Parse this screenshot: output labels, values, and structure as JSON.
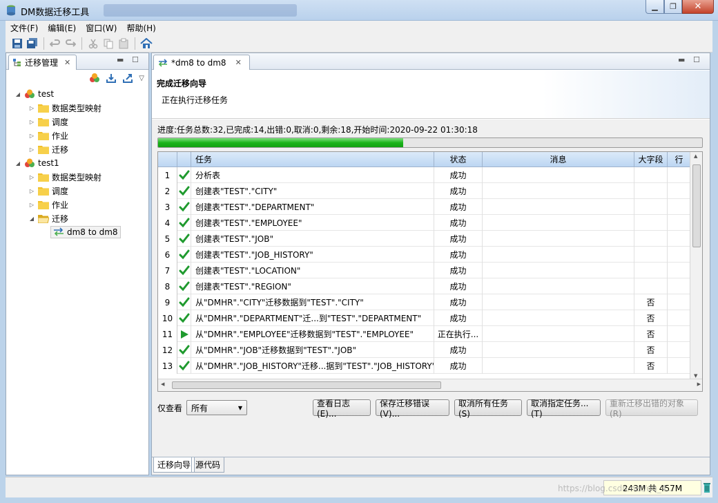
{
  "window": {
    "title": "DM数据迁移工具"
  },
  "menu": [
    "文件(F)",
    "编辑(E)",
    "窗口(W)",
    "帮助(H)"
  ],
  "left_panel": {
    "tab_label": "迁移管理",
    "tree": [
      {
        "label": "test",
        "level": 0,
        "expanded": true,
        "icon": "database-icon"
      },
      {
        "label": "数据类型映射",
        "level": 1,
        "expanded": false,
        "icon": "folder-icon"
      },
      {
        "label": "调度",
        "level": 1,
        "expanded": false,
        "icon": "folder-icon"
      },
      {
        "label": "作业",
        "level": 1,
        "expanded": false,
        "icon": "folder-icon"
      },
      {
        "label": "迁移",
        "level": 1,
        "expanded": false,
        "icon": "folder-icon"
      },
      {
        "label": "test1",
        "level": 0,
        "expanded": true,
        "icon": "database-icon"
      },
      {
        "label": "数据类型映射",
        "level": 1,
        "expanded": false,
        "icon": "folder-icon"
      },
      {
        "label": "调度",
        "level": 1,
        "expanded": false,
        "icon": "folder-icon"
      },
      {
        "label": "作业",
        "level": 1,
        "expanded": false,
        "icon": "folder-icon"
      },
      {
        "label": "迁移",
        "level": 1,
        "expanded": true,
        "icon": "folder-open-icon"
      },
      {
        "label": "dm8 to dm8",
        "level": 2,
        "expanded": false,
        "icon": "migration-icon",
        "selected": true
      }
    ]
  },
  "editor": {
    "tab_label": "*dm8 to dm8",
    "wizard_title": "完成迁移向导",
    "wizard_subtitle": "正在执行迁移任务",
    "progress_text": "进度:任务总数:32,已完成:14,出错:0,取消:0,剩余:18,开始时间:2020-09-22 01:30:18",
    "progress_fraction": 0.45,
    "columns": [
      "任务",
      "状态",
      "消息",
      "大字段",
      "行"
    ],
    "rows": [
      {
        "num": "1",
        "icon": "success",
        "task": "分析表",
        "status": "成功",
        "message": "",
        "lob": ""
      },
      {
        "num": "2",
        "icon": "success",
        "task": "创建表\"TEST\".\"CITY\"",
        "status": "成功",
        "message": "",
        "lob": ""
      },
      {
        "num": "3",
        "icon": "success",
        "task": "创建表\"TEST\".\"DEPARTMENT\"",
        "status": "成功",
        "message": "",
        "lob": ""
      },
      {
        "num": "4",
        "icon": "success",
        "task": "创建表\"TEST\".\"EMPLOYEE\"",
        "status": "成功",
        "message": "",
        "lob": ""
      },
      {
        "num": "5",
        "icon": "success",
        "task": "创建表\"TEST\".\"JOB\"",
        "status": "成功",
        "message": "",
        "lob": ""
      },
      {
        "num": "6",
        "icon": "success",
        "task": "创建表\"TEST\".\"JOB_HISTORY\"",
        "status": "成功",
        "message": "",
        "lob": ""
      },
      {
        "num": "7",
        "icon": "success",
        "task": "创建表\"TEST\".\"LOCATION\"",
        "status": "成功",
        "message": "",
        "lob": ""
      },
      {
        "num": "8",
        "icon": "success",
        "task": "创建表\"TEST\".\"REGION\"",
        "status": "成功",
        "message": "",
        "lob": ""
      },
      {
        "num": "9",
        "icon": "success",
        "task": "从\"DMHR\".\"CITY\"迁移数据到\"TEST\".\"CITY\"",
        "status": "成功",
        "message": "",
        "lob": "否"
      },
      {
        "num": "10",
        "icon": "success",
        "task": "从\"DMHR\".\"DEPARTMENT\"迁...到\"TEST\".\"DEPARTMENT\"",
        "status": "成功",
        "message": "",
        "lob": "否"
      },
      {
        "num": "11",
        "icon": "running",
        "task": "从\"DMHR\".\"EMPLOYEE\"迁移数据到\"TEST\".\"EMPLOYEE\"",
        "status": "正在执行...",
        "message": "",
        "lob": "否"
      },
      {
        "num": "12",
        "icon": "success",
        "task": "从\"DMHR\".\"JOB\"迁移数据到\"TEST\".\"JOB\"",
        "status": "成功",
        "message": "",
        "lob": "否"
      },
      {
        "num": "13",
        "icon": "success",
        "task": "从\"DMHR\".\"JOB_HISTORY\"迁移...据到\"TEST\".\"JOB_HISTORY\"",
        "status": "成功",
        "message": "",
        "lob": "否"
      }
    ],
    "filter_label": "仅查看",
    "filter_value": "所有",
    "buttons": [
      "查看日志(E)...",
      "保存迁移错误(V)...",
      "取消所有任务(S)",
      "取消指定任务...(T)",
      "重新迁移出错的对象(R)"
    ],
    "bottom_tabs": [
      "迁移向导",
      "源代码"
    ]
  },
  "status": {
    "memory": "243M 共 457M"
  },
  "watermark": "https://blog.csdn.net/qq_4..."
}
